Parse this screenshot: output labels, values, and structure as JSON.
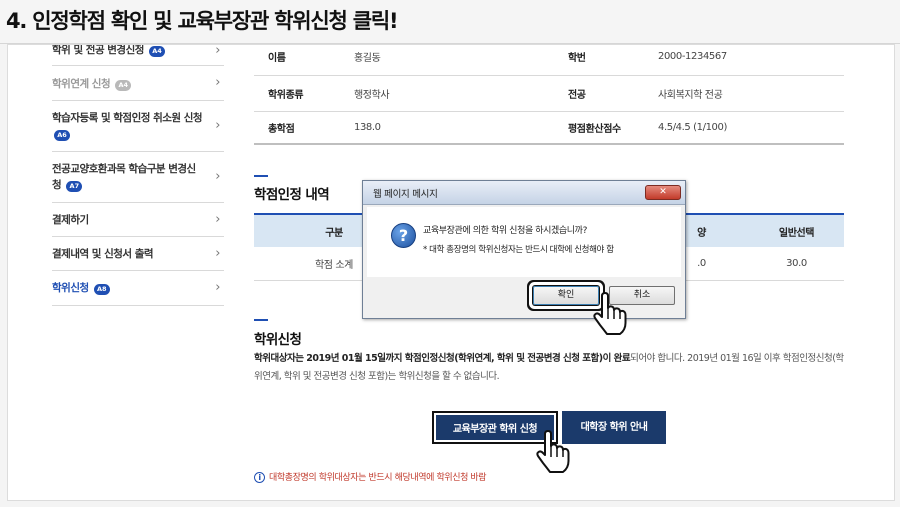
{
  "header": {
    "title": "4. 인정학점 확인 및 교육부장관 학위신청 클릭!"
  },
  "sidebar": {
    "items": [
      {
        "label": "학위 및 전공 변경신청",
        "badge": "A4",
        "style": "normal"
      },
      {
        "label": "학위연계 신청",
        "badge": "A4",
        "style": "dim"
      },
      {
        "label": "학습자등록 및 학점인정 취소원 신청",
        "badge": "A6",
        "style": "normal"
      },
      {
        "label": "전공교양호환과목 학습구분 변경신청",
        "badge": "A7",
        "style": "normal"
      },
      {
        "label": "결제하기",
        "badge": "",
        "style": "normal"
      },
      {
        "label": "결제내역 및 신청서 출력",
        "badge": "",
        "style": "normal"
      },
      {
        "label": "학위신청",
        "badge": "A8",
        "style": "active"
      }
    ],
    "chevron": "›"
  },
  "student_info": {
    "rows": [
      {
        "label1": "이름",
        "value1": "홍길동",
        "label2": "학번",
        "value2": "2000-1234567"
      },
      {
        "label1": "학위종류",
        "value1": "행정학사",
        "label2": "전공",
        "value2": "사회복지학 전공"
      },
      {
        "label1": "총학점",
        "value1": "138.0",
        "label2": "평점환산점수",
        "value2": "4.5/4.5 (1/100)"
      }
    ]
  },
  "credit_section": {
    "title": "학점인정 내역",
    "headers": [
      "구분",
      "",
      "",
      "",
      "양",
      "일반선택"
    ],
    "rows": [
      {
        "cells": [
          "학점 소계",
          "",
          "",
          "",
          ".0",
          "30.0"
        ]
      }
    ]
  },
  "degree_section": {
    "title": "학위신청",
    "notice_bold": "학위대상자는 2019년 01월 15일까지 학점인정신청(학위연계, 학위 및 전공변경 신청 포함)이 완료",
    "notice_rest": "되어야 합니다. 2019년 01월 16일 이후 학점인정신청(학위연계, 학위 및 전공변경 신청 포함)는 학위신청을 할 수 없습니다.",
    "btn_edu": "교육부장관 학위 신청",
    "btn_uni": "대학장 학위 안내",
    "warning": "대학총장명의 학위대상자는 반드시 해당내역에 학위신청 바람",
    "warning_icon": "i"
  },
  "dialog": {
    "title": "웹 페이지 메시지",
    "close": "✕",
    "icon": "?",
    "message": "교육부장관에 의한 학위 신청을 하시겠습니까?",
    "sub_message": "* 대학 총장명의 학위신청자는 반드시 대학에 신청해야 함",
    "ok": "확인",
    "cancel": "취소"
  },
  "colors": {
    "accent": "#1f4fb3",
    "button": "#1b3a6b",
    "warning": "#c0392b",
    "table_head": "#d8e6f3"
  }
}
